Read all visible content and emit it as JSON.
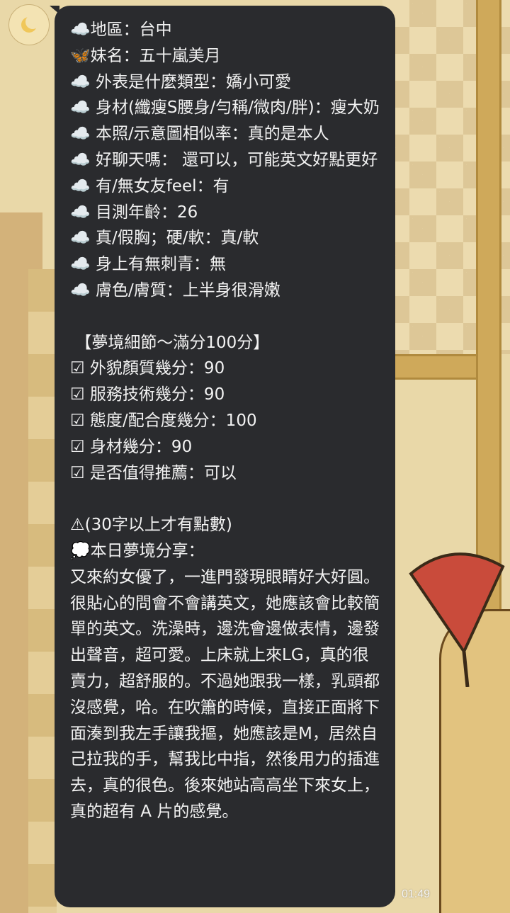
{
  "chat": {
    "message_text": "☁️地區：台中\n🦋妹名：五十嵐美月\n☁️ 外表是什麼類型：嬌小可愛\n☁️ 身材(纖瘦S腰身/勻稱/微肉/胖)：瘦大奶\n☁️ 本照/示意圖相似率：真的是本人\n☁️ 好聊天嗎： 還可以，可能英文好點更好\n☁️ 有/無女友feel：有\n☁️ 目測年齡：26\n☁️ 真/假胸；硬/軟：真/軟\n☁️ 身上有無刺青：無\n☁️ 膚色/膚質：上半身很滑嫩\n\n 【夢境細節～滿分100分】\n☑ 外貌顏質幾分：90\n☑ 服務技術幾分：90\n☑ 態度/配合度幾分：100\n☑ 身材幾分：90\n☑ 是否值得推薦：可以\n\n⚠(30字以上才有點數)\n💭本日夢境分享：\n又來約女優了，一進門發現眼睛好大好圓。很貼心的問會不會講英文，她應該會比較簡單的英文。洗澡時，邊洗會邊做表情，邊發出聲音，超可愛。上床就上來LG，真的很賣力，超舒服的。不過她跟我一樣，乳頭都沒感覺，哈。在吹簫的時候，直接正面將下面湊到我左手讓我摳，她應該是M，居然自己拉我的手，幫我比中指，然後用力的插進去，真的很色。後來她站高高坐下來女上，真的超有 A 片的感覺。",
    "timestamp": "01:49",
    "avatar_icon": "crescent-moon-icon",
    "bubble_color": "#2a2b2e",
    "text_color": "#f2f2f2"
  }
}
